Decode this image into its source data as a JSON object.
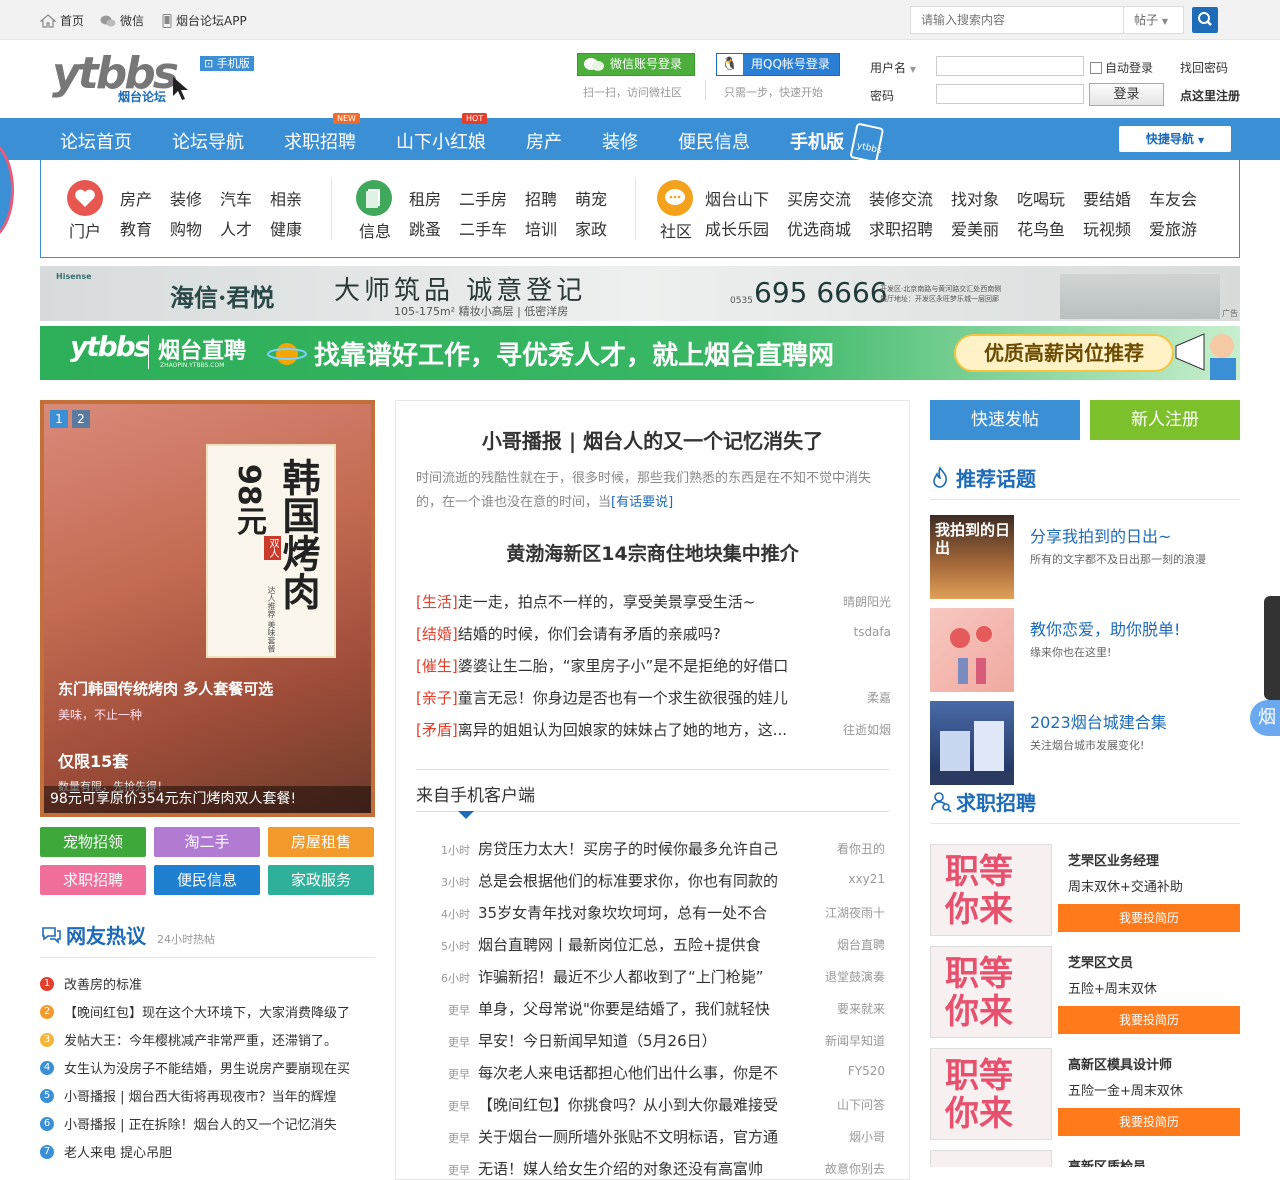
{
  "topbar": {
    "home": "首页",
    "wechat": "微信",
    "app": "烟台论坛APP",
    "search_placeholder": "请输入搜索内容",
    "search_type": "帖子"
  },
  "header": {
    "logo_text": "ytbbs",
    "logo_sub": "烟台论坛",
    "mobile_tag": "手机版",
    "wechat_login": "微信账号登录",
    "wechat_hint": "扫一扫，访问微社区",
    "qq_login": "用QQ帐号登录",
    "qq_hint": "只需一步，快速开始",
    "username_label": "用户名",
    "password_label": "密码",
    "auto_login": "自动登录",
    "find_pwd": "找回密码",
    "login_btn": "登录",
    "register_link": "点这里注册"
  },
  "nav": {
    "items": [
      "论坛首页",
      "论坛导航",
      "求职招聘",
      "山下小红娘",
      "房产",
      "装修",
      "便民信息",
      "手机版"
    ],
    "new_badge": "NEW",
    "hot_badge": "HOT",
    "quick_nav": "快捷导航"
  },
  "cats": {
    "g1": {
      "label": "门户",
      "r1": [
        "房产",
        "装修",
        "汽车",
        "相亲"
      ],
      "r2": [
        "教育",
        "购物",
        "人才",
        "健康"
      ]
    },
    "g2": {
      "label": "信息",
      "r1": [
        "租房",
        "二手房",
        "招聘",
        "萌宠"
      ],
      "r2": [
        "跳蚤",
        "二手车",
        "培训",
        "家政"
      ]
    },
    "g3": {
      "label": "社区",
      "r1": [
        "烟台山下",
        "买房交流",
        "装修交流",
        "找对象",
        "吃喝玩",
        "要结婚",
        "车友会"
      ],
      "r2": [
        "成长乐园",
        "优选商城",
        "求职招聘",
        "爱美丽",
        "花鸟鱼",
        "玩视频",
        "爱旅游"
      ]
    }
  },
  "banner1": {
    "brand": "海信·君悦",
    "slogan": "大师筑品 诚意登记",
    "area": "105-175m² 精妆小高层 | 低密洋房",
    "phone": "695 6666",
    "area_code": "0535",
    "addr1": "开发区·北京南路与黄河路交汇处西南侧",
    "addr2": "展厅地址：开发区永旺梦乐城一层回廊",
    "ad": "广告"
  },
  "banner2": {
    "brand": "ytbbs",
    "brand2": "烟台直聘",
    "sub": "ZHAOPIN.YTBBS.COM",
    "slogan": "找靠谱好工作，寻优秀人才，就上烟台直聘网",
    "tag": "优质高薪岗位推荐"
  },
  "slider": {
    "pages": [
      "1",
      "2"
    ],
    "food_title": "韩国烤肉",
    "price": "98元",
    "double": "双人",
    "note": "达人推荐·美味套餐",
    "title1": "东门韩国传统烤肉 多人套餐可选",
    "sub1": "美味，不止一种",
    "title2": "仅限15套",
    "sub2": "数量有限，先抢先得！",
    "caption": "98元可享原价354元东门烤肉双人套餐!"
  },
  "quick_btns": [
    "宠物招领",
    "淘二手",
    "房屋租售",
    "求职招聘",
    "便民信息",
    "家政服务"
  ],
  "hot": {
    "title": "网友热议",
    "sub": "24小时热帖",
    "items": [
      "改善房的标准",
      "【晚间红包】现在这个大环境下，大家消费降级了",
      "发帖大王：今年樱桃减产非常严重，还滞销了。",
      "女生认为没房子不能结婚，男生说房产要崩现在买",
      "小哥播报 | 烟台西大街将再现夜市？当年的辉煌",
      "小哥播报 | 正在拆除！烟台人的又一个记忆消失",
      "老人来电 提心吊胆"
    ]
  },
  "mid": {
    "head1": "小哥播报 | 烟台人的又一个记忆消失了",
    "desc1": "时间流逝的残酷性就在于，很多时候，那些我们熟悉的东西是在不知不觉中消失的，在一个谁也没在意的时间，当",
    "more": "[有话要说]",
    "head2": "黄渤海新区14宗商住地块集中推介",
    "news": [
      {
        "tag": "[生活]",
        "text": "走一走，拍点不一样的，享受美景享受生活~",
        "au": "晴朗阳光"
      },
      {
        "tag": "[结婚]",
        "text": "结婚的时候，你们会请有矛盾的亲戚吗?",
        "au": "tsdafa"
      },
      {
        "tag": "[催生]",
        "text": "婆婆让生二胎，“家里房子小”是不是拒绝的好借口",
        "au": ""
      },
      {
        "tag": "[亲子]",
        "text": "童言无忌！你身边是否也有一个求生欲很强的娃儿",
        "au": "柔嘉"
      },
      {
        "tag": "[矛盾]",
        "text": "离异的姐姐认为回娘家的妹妹占了她的地方，这...",
        "au": "往逝如烟"
      }
    ],
    "mobile_title": "来自手机客户端",
    "mobile": [
      {
        "t": "1小时",
        "text": "房贷压力太大！买房子的时候你最多允许自己",
        "au": "看你丑的"
      },
      {
        "t": "3小时",
        "text": "总是会根据他们的标准要求你，你也有同款的",
        "au": "xxy21"
      },
      {
        "t": "4小时",
        "text": "35岁女青年找对象坎坎坷坷，总有一处不合",
        "au": "江湖夜雨十"
      },
      {
        "t": "5小时",
        "text": "烟台直聘网丨最新岗位汇总，五险+提供食",
        "au": "烟台直聘"
      },
      {
        "t": "6小时",
        "text": "诈骗新招！最近不少人都收到了“上门枪毙”",
        "au": "退堂鼓演奏"
      },
      {
        "t": "更早",
        "text": "单身，父母常说\"你要是结婚了，我们就轻快",
        "au": "要来就来"
      },
      {
        "t": "更早",
        "text": "早安！今日新闻早知道（5月26日）",
        "au": "新闻早知道"
      },
      {
        "t": "更早",
        "text": "每次老人来电话都担心他们出什么事，你是不",
        "au": "FY520"
      },
      {
        "t": "更早",
        "text": "【晚间红包】你挑食吗？从小到大你最难接受",
        "au": "山下问答"
      },
      {
        "t": "更早",
        "text": "关于烟台一厕所墙外张贴不文明标语，官方通",
        "au": "烟小哥"
      },
      {
        "t": "更早",
        "text": "无语！媒人给女生介绍的对象还没有高富帅",
        "au": "故意你别去"
      }
    ]
  },
  "right": {
    "post_btn": "快速发帖",
    "reg_btn": "新人注册",
    "topic_title": "推荐话题",
    "topics": [
      {
        "t": "分享我拍到的日出~",
        "d": "所有的文字都不及日出那一刻的浪漫",
        "img": "我拍到的日出"
      },
      {
        "t": "教你恋爱，助你脱单!",
        "d": "缘来你也在这里!",
        "img": ""
      },
      {
        "t": "2023烟台城建合集",
        "d": "关注烟台城市发展变化!",
        "img": ""
      }
    ],
    "job_title": "求职招聘",
    "job_img": "职等你来",
    "job_btn": "我要投简历",
    "jobs": [
      {
        "t": "芝罘区业务经理",
        "d": "周末双休+交通补助"
      },
      {
        "t": "芝罘区文员",
        "d": "五险+周末双休"
      },
      {
        "t": "高新区模具设计师",
        "d": "五险一金+周末双休"
      },
      {
        "t": "高新区质检员",
        "d": ""
      }
    ],
    "side_tab": "烟"
  }
}
